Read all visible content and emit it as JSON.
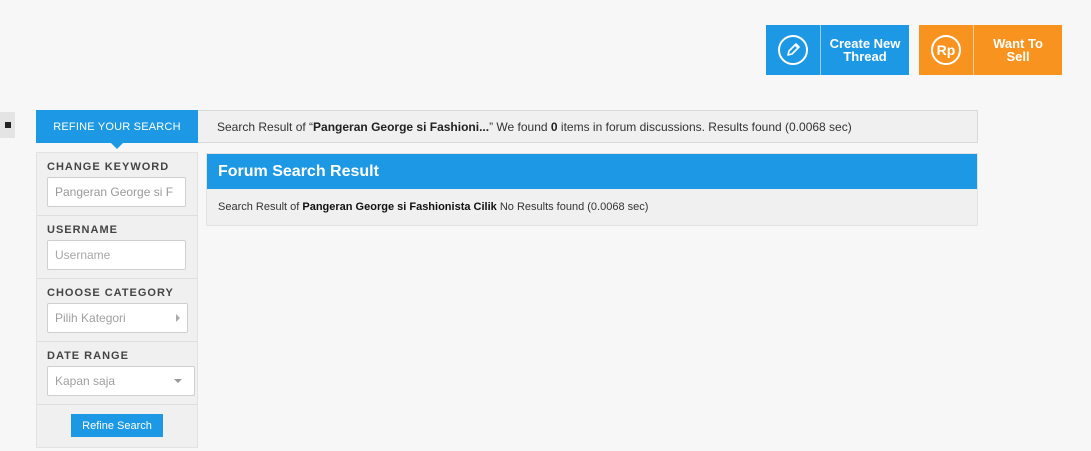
{
  "top_buttons": {
    "create_thread": {
      "label": "Create New Thread",
      "icon": "pencil-icon",
      "color": "#1d98e4"
    },
    "want_to_sell": {
      "label": "Want To Sell",
      "icon_text": "Rp",
      "color": "#f7931e"
    }
  },
  "search_bar": {
    "refine_tab": "REFINE YOUR SEARCH",
    "prefix": "Search Result of “",
    "keyword": "Pangeran George si Fashioni...",
    "middle": "” We found ",
    "count": "0",
    "suffix": " items in forum discussions. Results found (0.0068 sec)"
  },
  "sidebar": {
    "keyword": {
      "label": "CHANGE KEYWORD",
      "value": "Pangeran George si F"
    },
    "username": {
      "label": "USERNAME",
      "placeholder": "Username"
    },
    "category": {
      "label": "CHOOSE CATEGORY",
      "value": "Pilih Kategori"
    },
    "date_range": {
      "label": "DATE RANGE",
      "value": "Kapan saja"
    },
    "refine_button": "Refine Search"
  },
  "results": {
    "title": "Forum Search Result",
    "prefix": "Search Result of ",
    "keyword": "Pangeran George si Fashionista Cilik",
    "suffix": " No Results found (0.0068 sec)"
  },
  "colors": {
    "accent": "#1d98e4",
    "sell": "#f7931e"
  }
}
